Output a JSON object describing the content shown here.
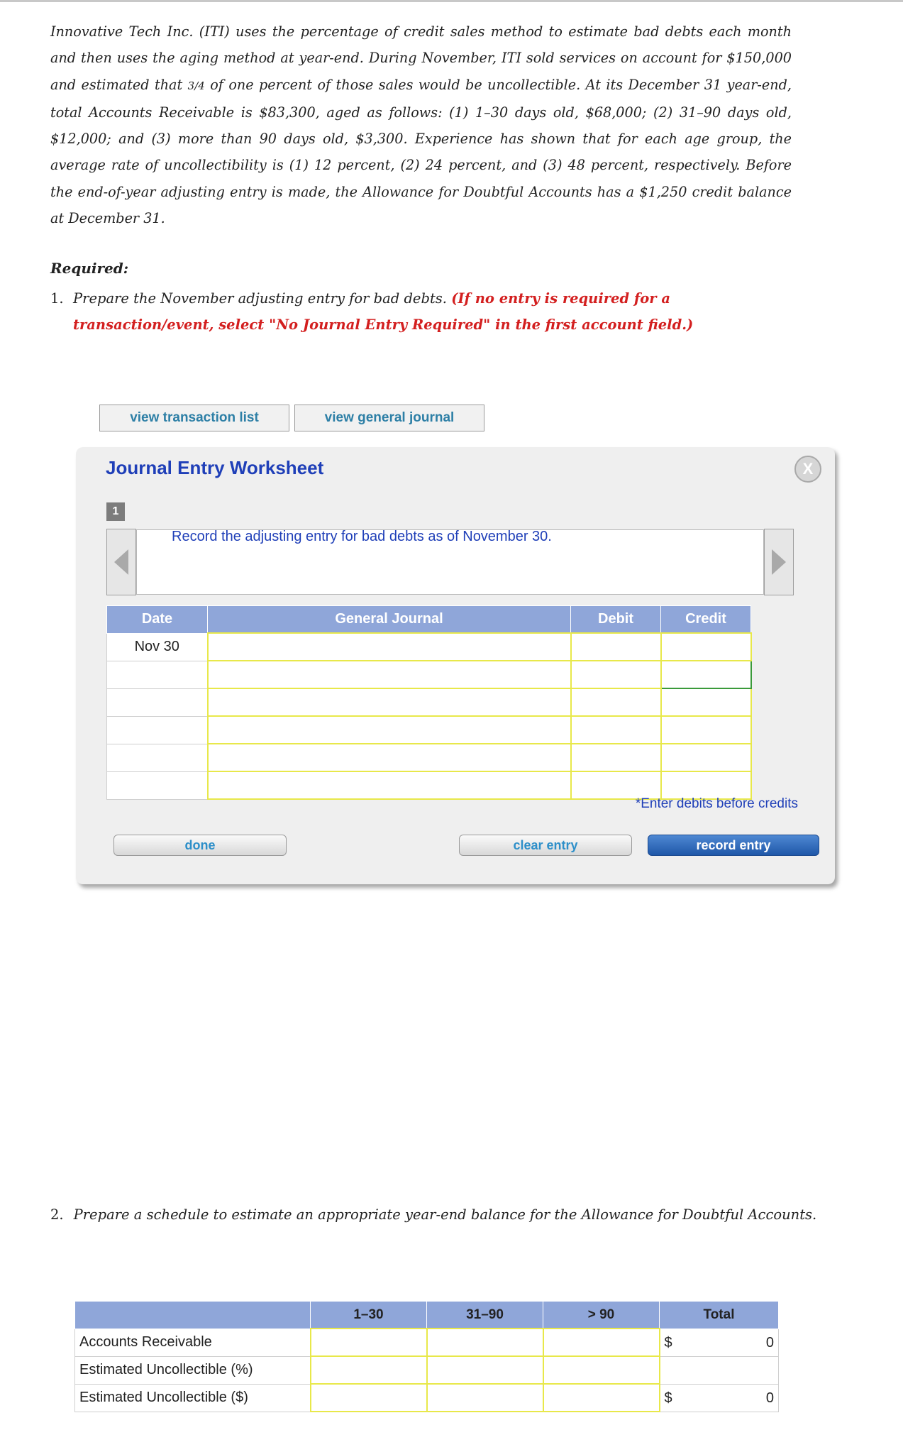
{
  "intro": {
    "p1": "Innovative Tech Inc. (ITI) uses the percentage of credit sales method to estimate bad debts each month and then uses the aging method at year-end. During November, ITI sold services on account for $150,000 and estimated that ",
    "frac": "3/4",
    "p2": " of one percent of those sales would be uncollectible. At its December 31 year-end, total Accounts Receivable is $83,300, aged as follows: (1) 1–30 days old, $68,000; (2) 31–90 days old, $12,000; and (3) more than 90 days old, $3,300. Experience has shown that for each age group, the average rate of uncollectibility is (1) 12 percent, (2) 24 percent, and (3) 48 percent, respectively. Before the end-of-year adjusting entry is made, the Allowance for Doubtful Accounts has a $1,250 credit balance at December 31."
  },
  "required": {
    "heading": "Required:",
    "q1_num": "1.",
    "q1_text": "Prepare the November adjusting entry for bad debts. ",
    "q1_note": "(If no entry is required for a transaction/event, select \"No Journal Entry Required\" in the first account field.)",
    "q2_num": "2.",
    "q2_text": "Prepare a schedule to estimate an appropriate year-end balance for the Allowance for Doubtful Accounts."
  },
  "tabs": {
    "transaction_list": "view transaction list",
    "general_journal": "view general journal"
  },
  "worksheet": {
    "title": "Journal Entry Worksheet",
    "close": "X",
    "step": "1",
    "instruction": "Record the adjusting entry for bad debts as of November 30.",
    "headers": {
      "date": "Date",
      "journal": "General Journal",
      "debit": "Debit",
      "credit": "Credit"
    },
    "first_date": "Nov 30",
    "note": "*Enter debits before credits",
    "buttons": {
      "done": "done",
      "clear": "clear entry",
      "record": "record entry"
    }
  },
  "schedule": {
    "headers": {
      "c1": "1–30",
      "c2": "31–90",
      "c3": "> 90",
      "total": "Total"
    },
    "rows": {
      "ar": {
        "label": "Accounts Receivable",
        "currency": "$",
        "total": "0"
      },
      "pct": {
        "label": "Estimated Uncollectible (%)"
      },
      "amt": {
        "label": "Estimated Uncollectible ($)",
        "currency": "$",
        "total": "0"
      }
    }
  }
}
